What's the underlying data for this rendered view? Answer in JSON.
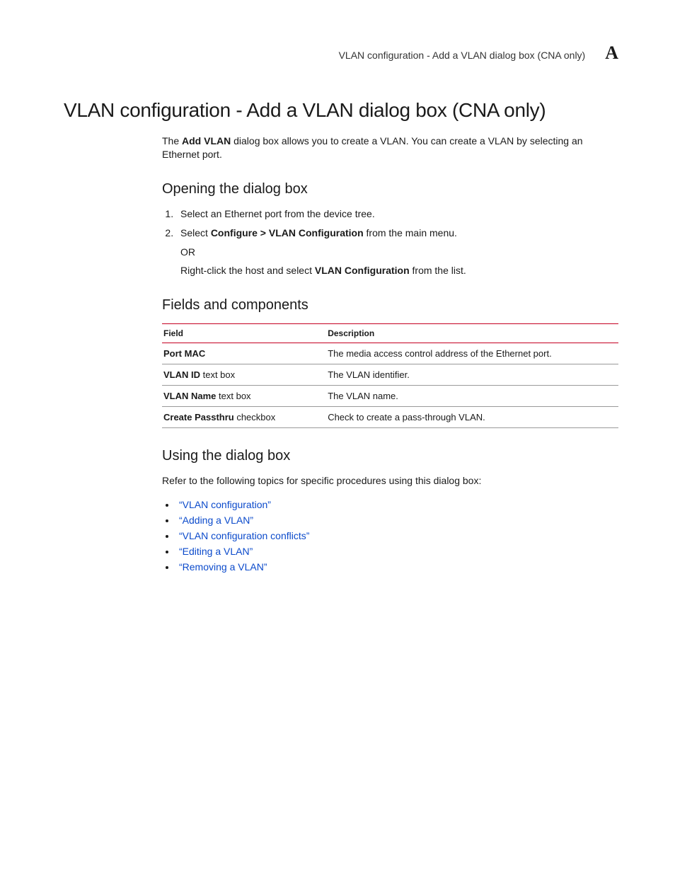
{
  "header": {
    "running_title": "VLAN configuration - Add a VLAN dialog box (CNA only)",
    "appendix_letter": "A"
  },
  "title": "VLAN configuration - Add a VLAN dialog box (CNA only)",
  "intro": {
    "prefix": "The ",
    "bold": "Add VLAN",
    "suffix": " dialog box allows you to create a VLAN. You can create a VLAN by selecting an Ethernet port."
  },
  "sections": {
    "opening": {
      "heading": "Opening the dialog box",
      "step1": "Select an Ethernet port from the device tree.",
      "step2_prefix": "Select ",
      "step2_bold": "Configure > VLAN Configuration",
      "step2_suffix": " from the main menu.",
      "or": "OR",
      "alt_prefix": "Right-click the host and select ",
      "alt_bold": "VLAN Configuration",
      "alt_suffix": " from the list."
    },
    "fields": {
      "heading": "Fields and components",
      "columns": {
        "field": "Field",
        "desc": "Description"
      },
      "rows": [
        {
          "field_bold": "Port MAC",
          "field_suffix": "",
          "desc": "The media access control address of the Ethernet port."
        },
        {
          "field_bold": "VLAN ID",
          "field_suffix": " text box",
          "desc": "The VLAN identifier."
        },
        {
          "field_bold": "VLAN Name",
          "field_suffix": " text box",
          "desc": "The VLAN name."
        },
        {
          "field_bold": "Create Passthru",
          "field_suffix": " checkbox",
          "desc": "Check to create a pass-through VLAN."
        }
      ]
    },
    "using": {
      "heading": "Using the dialog box",
      "intro": "Refer to the following topics for specific procedures using this dialog box:",
      "links": [
        "“VLAN configuration”",
        "“Adding a VLAN”",
        "“VLAN configuration conflicts”",
        "“Editing a VLAN”",
        "“Removing a VLAN”"
      ]
    }
  }
}
